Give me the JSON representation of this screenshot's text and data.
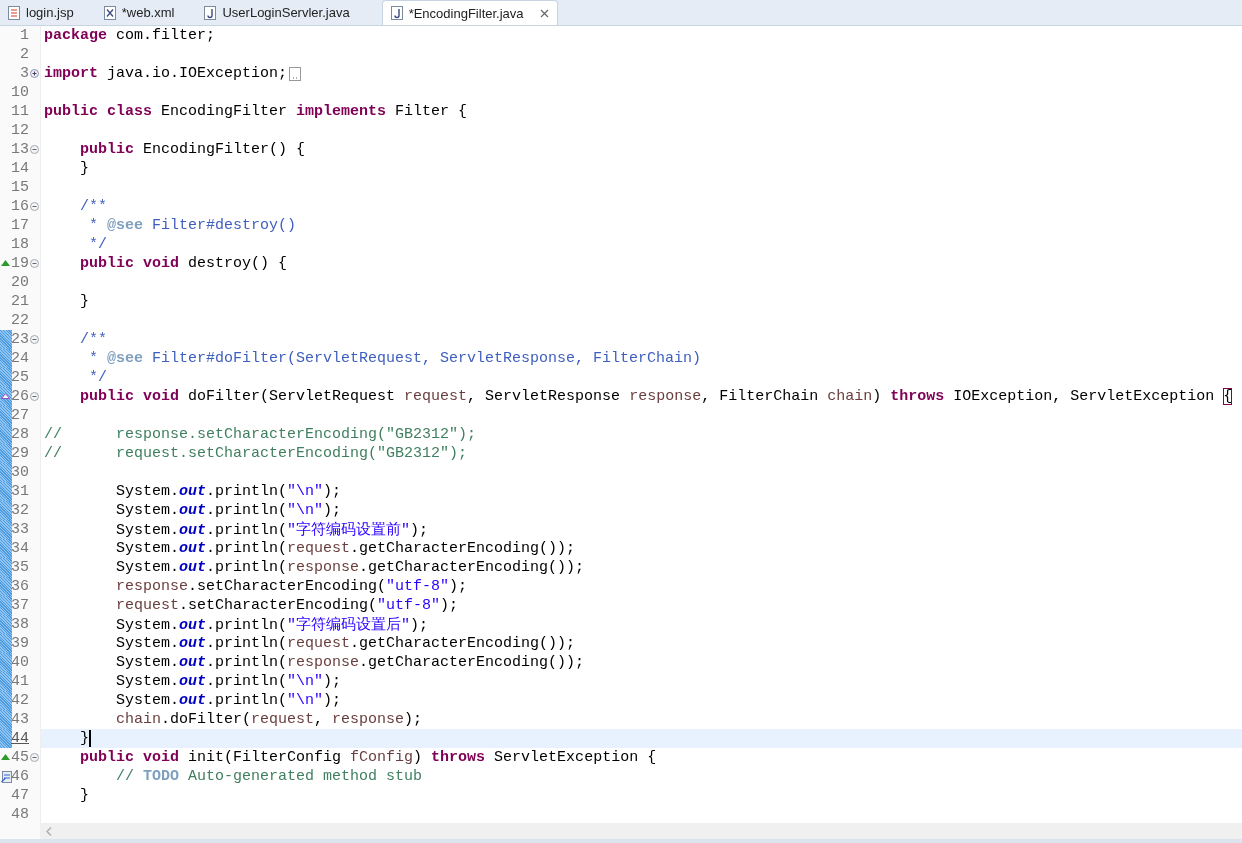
{
  "tabs": [
    {
      "label": "login.jsp",
      "kind": "jsp",
      "selected": false,
      "closable": false
    },
    {
      "label": "*web.xml",
      "kind": "xml",
      "selected": false,
      "closable": false
    },
    {
      "label": "UserLoginServler.java",
      "kind": "java",
      "selected": false,
      "closable": false
    },
    {
      "label": "*EncodingFilter.java",
      "kind": "java",
      "selected": true,
      "closable": true
    }
  ],
  "lines": [
    {
      "number": "1",
      "kind": "code",
      "changed": false,
      "current": false,
      "tokens": [
        {
          "text": "package ",
          "kind": "kw"
        },
        {
          "text": "com.filter;",
          "kind": "txt"
        }
      ]
    },
    {
      "number": "2",
      "kind": "code",
      "changed": false,
      "current": false
    },
    {
      "number": "3",
      "kind": "code",
      "changed": false,
      "current": false,
      "fold": {
        "expanded": false
      },
      "tokens": [
        {
          "text": "import ",
          "kind": "kw"
        },
        {
          "text": "java.io.IOException;",
          "kind": "txt"
        }
      ]
    },
    {
      "number": "10",
      "kind": "code",
      "changed": false,
      "current": false
    },
    {
      "number": "11",
      "kind": "code",
      "changed": false,
      "current": false,
      "tokens": [
        {
          "text": "public class ",
          "kind": "kw"
        },
        {
          "text": "EncodingFilter ",
          "kind": "txt"
        },
        {
          "text": "implements ",
          "kind": "kw"
        },
        {
          "text": "Filter {",
          "kind": "txt"
        }
      ]
    },
    {
      "number": "12",
      "kind": "code",
      "changed": false,
      "current": false
    },
    {
      "number": "13",
      "kind": "code",
      "changed": false,
      "current": false,
      "fold": {
        "expanded": true
      },
      "tokens": [
        {
          "text": "    public ",
          "kind": "kw"
        },
        {
          "text": "EncodingFilter() {",
          "kind": "txt"
        }
      ]
    },
    {
      "number": "14",
      "kind": "code",
      "changed": false,
      "current": false,
      "tokens": [
        {
          "text": "    }",
          "kind": "txt"
        }
      ]
    },
    {
      "number": "15",
      "kind": "code",
      "changed": false,
      "current": false
    },
    {
      "number": "16",
      "kind": "code",
      "changed": false,
      "current": false,
      "fold": {
        "expanded": true
      },
      "tokens": [
        {
          "text": "    /**",
          "kind": "doc"
        }
      ]
    },
    {
      "number": "17",
      "kind": "code",
      "changed": false,
      "current": false,
      "tokens": [
        {
          "text": "     * ",
          "kind": "doc"
        },
        {
          "text": "@see",
          "kind": "tag"
        },
        {
          "text": " Filter#destroy()",
          "kind": "doc"
        }
      ]
    },
    {
      "number": "18",
      "kind": "code",
      "changed": false,
      "current": false,
      "tokens": [
        {
          "text": "     */",
          "kind": "doc"
        }
      ]
    },
    {
      "number": "19",
      "kind": "override",
      "changed": false,
      "current": false,
      "fold": {
        "expanded": true
      },
      "tokens": [
        {
          "text": "    public void ",
          "kind": "kw"
        },
        {
          "text": "destroy() {",
          "kind": "txt"
        }
      ]
    },
    {
      "number": "20",
      "kind": "code",
      "changed": false,
      "current": false
    },
    {
      "number": "21",
      "kind": "code",
      "changed": false,
      "current": false,
      "tokens": [
        {
          "text": "    }",
          "kind": "txt"
        }
      ]
    },
    {
      "number": "22",
      "kind": "code",
      "changed": false,
      "current": false
    },
    {
      "number": "23",
      "kind": "code",
      "changed": true,
      "current": false,
      "fold": {
        "expanded": true
      },
      "tokens": [
        {
          "text": "    /**",
          "kind": "doc"
        }
      ]
    },
    {
      "number": "24",
      "kind": "code",
      "changed": true,
      "current": false,
      "tokens": [
        {
          "text": "     * ",
          "kind": "doc"
        },
        {
          "text": "@see",
          "kind": "tag"
        },
        {
          "text": " Filter#doFilter(ServletRequest, ServletResponse, FilterChain)",
          "kind": "doc"
        }
      ]
    },
    {
      "number": "25",
      "kind": "code",
      "changed": true,
      "current": false,
      "tokens": [
        {
          "text": "     */",
          "kind": "doc"
        }
      ]
    },
    {
      "number": "26",
      "kind": "implements",
      "changed": true,
      "current": false,
      "fold": {
        "expanded": true
      },
      "tokens": [
        {
          "text": "    public void ",
          "kind": "kw"
        },
        {
          "text": "doFilter(ServletRequest ",
          "kind": "txt"
        },
        {
          "text": "request",
          "kind": "local"
        },
        {
          "text": ", ServletResponse ",
          "kind": "txt"
        },
        {
          "text": "response",
          "kind": "local"
        },
        {
          "text": ", FilterChain ",
          "kind": "txt"
        },
        {
          "text": "chain",
          "kind": "local"
        },
        {
          "text": ") ",
          "kind": "txt"
        },
        {
          "text": "throws",
          "kind": "kw"
        },
        {
          "text": " IOException, ServletException ",
          "kind": "txt"
        },
        {
          "text": "{",
          "kind": "match"
        }
      ]
    },
    {
      "number": "27",
      "kind": "code",
      "changed": true,
      "current": false
    },
    {
      "number": "28",
      "kind": "code",
      "changed": true,
      "current": false,
      "tokens": [
        {
          "text": "//      response.setCharacterEncoding(\"GB2312\");",
          "kind": "cmt"
        }
      ]
    },
    {
      "number": "29",
      "kind": "code",
      "changed": true,
      "current": false,
      "tokens": [
        {
          "text": "//      request.setCharacterEncoding(\"GB2312\");",
          "kind": "cmt"
        }
      ]
    },
    {
      "number": "30",
      "kind": "code",
      "changed": true,
      "current": false
    },
    {
      "number": "31",
      "kind": "code",
      "changed": true,
      "current": false,
      "tokens": [
        {
          "text": "        System.",
          "kind": "txt"
        },
        {
          "text": "out",
          "kind": "field"
        },
        {
          "text": ".println(",
          "kind": "txt"
        },
        {
          "text": "\"\\n\"",
          "kind": "str"
        },
        {
          "text": ");",
          "kind": "txt"
        }
      ]
    },
    {
      "number": "32",
      "kind": "code",
      "changed": true,
      "current": false,
      "tokens": [
        {
          "text": "        System.",
          "kind": "txt"
        },
        {
          "text": "out",
          "kind": "field"
        },
        {
          "text": ".println(",
          "kind": "txt"
        },
        {
          "text": "\"\\n\"",
          "kind": "str"
        },
        {
          "text": ");",
          "kind": "txt"
        }
      ]
    },
    {
      "number": "33",
      "kind": "code",
      "changed": true,
      "current": false,
      "tokens": [
        {
          "text": "        System.",
          "kind": "txt"
        },
        {
          "text": "out",
          "kind": "field"
        },
        {
          "text": ".println(",
          "kind": "txt"
        },
        {
          "text": "\"字符编码设置前\"",
          "kind": "str"
        },
        {
          "text": ");",
          "kind": "txt"
        }
      ]
    },
    {
      "number": "34",
      "kind": "code",
      "changed": true,
      "current": false,
      "tokens": [
        {
          "text": "        System.",
          "kind": "txt"
        },
        {
          "text": "out",
          "kind": "field"
        },
        {
          "text": ".println(",
          "kind": "txt"
        },
        {
          "text": "request",
          "kind": "local"
        },
        {
          "text": ".getCharacterEncoding());",
          "kind": "txt"
        }
      ]
    },
    {
      "number": "35",
      "kind": "code",
      "changed": true,
      "current": false,
      "tokens": [
        {
          "text": "        System.",
          "kind": "txt"
        },
        {
          "text": "out",
          "kind": "field"
        },
        {
          "text": ".println(",
          "kind": "txt"
        },
        {
          "text": "response",
          "kind": "local"
        },
        {
          "text": ".getCharacterEncoding());",
          "kind": "txt"
        }
      ]
    },
    {
      "number": "36",
      "kind": "code",
      "changed": true,
      "current": false,
      "tokens": [
        {
          "text": "        response",
          "kind": "local"
        },
        {
          "text": ".setCharacterEncoding(",
          "kind": "txt"
        },
        {
          "text": "\"utf-8\"",
          "kind": "str"
        },
        {
          "text": ");",
          "kind": "txt"
        }
      ]
    },
    {
      "number": "37",
      "kind": "code",
      "changed": true,
      "current": false,
      "tokens": [
        {
          "text": "        request",
          "kind": "local"
        },
        {
          "text": ".setCharacterEncoding(",
          "kind": "txt"
        },
        {
          "text": "\"utf-8\"",
          "kind": "str"
        },
        {
          "text": ");",
          "kind": "txt"
        }
      ]
    },
    {
      "number": "38",
      "kind": "code",
      "changed": true,
      "current": false,
      "tokens": [
        {
          "text": "        System.",
          "kind": "txt"
        },
        {
          "text": "out",
          "kind": "field"
        },
        {
          "text": ".println(",
          "kind": "txt"
        },
        {
          "text": "\"字符编码设置后\"",
          "kind": "str"
        },
        {
          "text": ");",
          "kind": "txt"
        }
      ]
    },
    {
      "number": "39",
      "kind": "code",
      "changed": true,
      "current": false,
      "tokens": [
        {
          "text": "        System.",
          "kind": "txt"
        },
        {
          "text": "out",
          "kind": "field"
        },
        {
          "text": ".println(",
          "kind": "txt"
        },
        {
          "text": "request",
          "kind": "local"
        },
        {
          "text": ".getCharacterEncoding());",
          "kind": "txt"
        }
      ]
    },
    {
      "number": "40",
      "kind": "code",
      "changed": true,
      "current": false,
      "tokens": [
        {
          "text": "        System.",
          "kind": "txt"
        },
        {
          "text": "out",
          "kind": "field"
        },
        {
          "text": ".println(",
          "kind": "txt"
        },
        {
          "text": "response",
          "kind": "local"
        },
        {
          "text": ".getCharacterEncoding());",
          "kind": "txt"
        }
      ]
    },
    {
      "number": "41",
      "kind": "code",
      "changed": true,
      "current": false,
      "tokens": [
        {
          "text": "        System.",
          "kind": "txt"
        },
        {
          "text": "out",
          "kind": "field"
        },
        {
          "text": ".println(",
          "kind": "txt"
        },
        {
          "text": "\"\\n\"",
          "kind": "str"
        },
        {
          "text": ");",
          "kind": "txt"
        }
      ]
    },
    {
      "number": "42",
      "kind": "code",
      "changed": true,
      "current": false,
      "tokens": [
        {
          "text": "        System.",
          "kind": "txt"
        },
        {
          "text": "out",
          "kind": "field"
        },
        {
          "text": ".println(",
          "kind": "txt"
        },
        {
          "text": "\"\\n\"",
          "kind": "str"
        },
        {
          "text": ");",
          "kind": "txt"
        }
      ]
    },
    {
      "number": "43",
      "kind": "code",
      "changed": true,
      "current": false,
      "tokens": [
        {
          "text": "        chain",
          "kind": "local"
        },
        {
          "text": ".doFilter(",
          "kind": "txt"
        },
        {
          "text": "request",
          "kind": "local"
        },
        {
          "text": ", ",
          "kind": "txt"
        },
        {
          "text": "response",
          "kind": "local"
        },
        {
          "text": ");",
          "kind": "txt"
        }
      ]
    },
    {
      "number": "44",
      "kind": "code",
      "changed": true,
      "current": true,
      "tokens": [
        {
          "text": "    }",
          "kind": "txt"
        }
      ]
    },
    {
      "number": "45",
      "kind": "override",
      "changed": false,
      "current": false,
      "fold": {
        "expanded": true
      },
      "tokens": [
        {
          "text": "    public void ",
          "kind": "kw"
        },
        {
          "text": "init(FilterConfig ",
          "kind": "txt"
        },
        {
          "text": "fConfig",
          "kind": "local"
        },
        {
          "text": ") ",
          "kind": "txt"
        },
        {
          "text": "throws",
          "kind": "kw"
        },
        {
          "text": " ServletException {",
          "kind": "txt"
        }
      ]
    },
    {
      "number": "46",
      "kind": "task",
      "changed": false,
      "current": false,
      "tokens": [
        {
          "text": "        // ",
          "kind": "cmt"
        },
        {
          "text": "TODO",
          "kind": "task"
        },
        {
          "text": " Auto-generated method stub",
          "kind": "cmt"
        }
      ]
    },
    {
      "number": "47",
      "kind": "code",
      "changed": false,
      "current": false,
      "tokens": [
        {
          "text": "    }",
          "kind": "txt"
        }
      ]
    },
    {
      "number": "48",
      "kind": "code",
      "changed": false,
      "current": false
    }
  ]
}
